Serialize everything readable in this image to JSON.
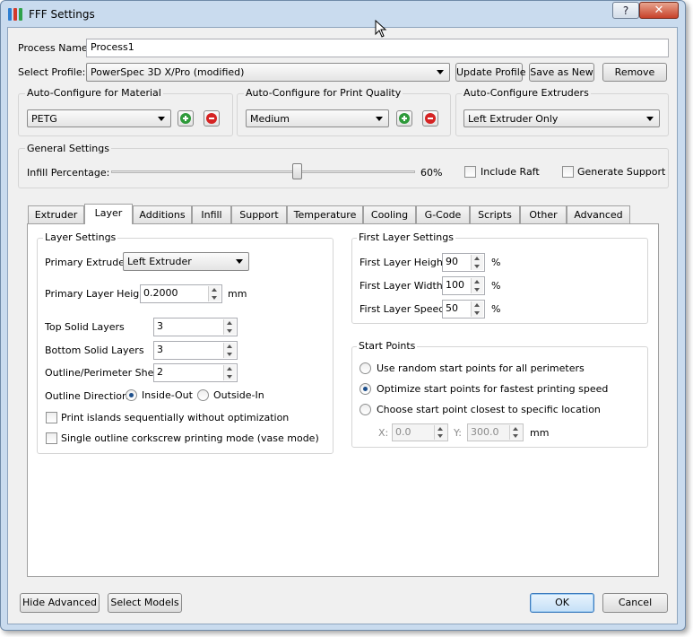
{
  "window": {
    "title": "FFF Settings",
    "help_label": "?",
    "close_label": "✕"
  },
  "process": {
    "name_label": "Process Name:",
    "name_value": "Process1"
  },
  "profile": {
    "label": "Select Profile:",
    "value": "PowerSpec 3D X/Pro (modified)",
    "update_label": "Update Profile",
    "save_as_label": "Save as New",
    "remove_label": "Remove"
  },
  "auto_material": {
    "title": "Auto-Configure for Material",
    "value": "PETG"
  },
  "auto_quality": {
    "title": "Auto-Configure for Print Quality",
    "value": "Medium"
  },
  "auto_extruders": {
    "title": "Auto-Configure Extruders",
    "value": "Left Extruder Only"
  },
  "general": {
    "title": "General Settings",
    "infill_label": "Infill Percentage:",
    "infill_value": "60%",
    "infill_fraction": 0.6,
    "raft_label": "Include Raft",
    "raft_checked": false,
    "support_label": "Generate Support",
    "support_checked": false
  },
  "tabs": [
    "Extruder",
    "Layer",
    "Additions",
    "Infill",
    "Support",
    "Temperature",
    "Cooling",
    "G-Code",
    "Scripts",
    "Other",
    "Advanced"
  ],
  "active_tab": "Layer",
  "layer_settings": {
    "title": "Layer Settings",
    "primary_extruder_label": "Primary Extruder",
    "primary_extruder_value": "Left Extruder",
    "primary_layer_height_label": "Primary Layer Height",
    "primary_layer_height_value": "0.2000",
    "primary_layer_height_unit": "mm",
    "top_solid_label": "Top Solid Layers",
    "top_solid_value": "3",
    "bottom_solid_label": "Bottom Solid Layers",
    "bottom_solid_value": "3",
    "outline_shells_label": "Outline/Perimeter Shells",
    "outline_shells_value": "2",
    "outline_direction_label": "Outline Direction:",
    "inside_out_label": "Inside-Out",
    "outside_in_label": "Outside-In",
    "outline_direction_selected": "inside-out",
    "print_islands_label": "Print islands sequentially without optimization",
    "print_islands_checked": false,
    "vase_mode_label": "Single outline corkscrew printing mode (vase mode)",
    "vase_mode_checked": false
  },
  "first_layer": {
    "title": "First Layer Settings",
    "height_label": "First Layer Height",
    "height_value": "90",
    "width_label": "First Layer Width",
    "width_value": "100",
    "speed_label": "First Layer Speed",
    "speed_value": "50",
    "unit": "%"
  },
  "start_points": {
    "title": "Start Points",
    "random_label": "Use random start points for all perimeters",
    "optimize_label": "Optimize start points for fastest printing speed",
    "closest_label": "Choose start point closest to specific location",
    "selected": "optimize",
    "x_label": "X:",
    "x_value": "0.0",
    "y_label": "Y:",
    "y_value": "300.0",
    "unit": "mm"
  },
  "footer": {
    "hide_advanced_label": "Hide Advanced",
    "select_models_label": "Select Models",
    "ok_label": "OK",
    "cancel_label": "Cancel"
  },
  "colors": {
    "plus_green": "#2e9a3a",
    "minus_red": "#d52323",
    "accent_blue": "#3d7bbd"
  }
}
